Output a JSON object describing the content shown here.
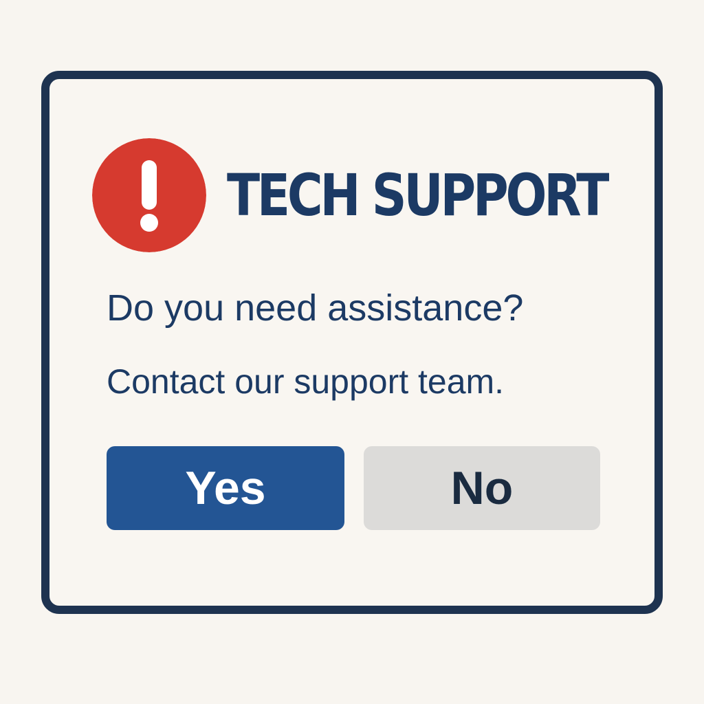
{
  "dialog": {
    "title": "TECH SUPPORT",
    "icon": "exclamation-alert-icon",
    "question": "Do you need assistance?",
    "message": "Contact our support team.",
    "buttons": {
      "yes_label": "Yes",
      "no_label": "No"
    }
  },
  "colors": {
    "background": "#f8f5f0",
    "border": "#1e3350",
    "title_text": "#1c3a64",
    "alert_red": "#d63a2f",
    "primary_button": "#235594",
    "secondary_button": "#dcdbd9"
  }
}
